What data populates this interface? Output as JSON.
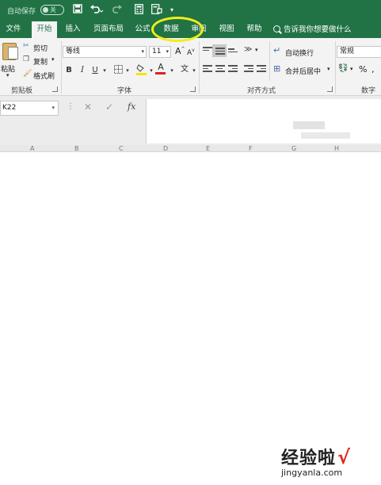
{
  "titlebar": {
    "autosave_label": "自动保存",
    "autosave_state": "关",
    "save_icon": "save-icon",
    "undo_icon": "undo-icon",
    "redo_icon": "redo-icon",
    "calc_icon": "calculator-icon",
    "form_icon": "form-icon",
    "customize_icon": "chevron-down-icon",
    "accent": "#217346"
  },
  "tabs": [
    {
      "label": "文件",
      "active": false
    },
    {
      "label": "开始",
      "active": true
    },
    {
      "label": "插入",
      "active": false
    },
    {
      "label": "页面布局",
      "active": false
    },
    {
      "label": "公式",
      "active": false
    },
    {
      "label": "数据",
      "active": false,
      "highlighted": true
    },
    {
      "label": "审阅",
      "active": false
    },
    {
      "label": "视图",
      "active": false
    },
    {
      "label": "帮助",
      "active": false
    }
  ],
  "tellme": "告诉我你想要做什么",
  "highlight_color": "#f2ee18",
  "ribbon": {
    "clipboard": {
      "paste": "粘贴",
      "cut": "剪切",
      "copy": "复制",
      "format_painter": "格式刷",
      "label": "剪贴板"
    },
    "font": {
      "name": "等线",
      "size": "11",
      "bold": "B",
      "italic": "I",
      "underline": "U",
      "grow": "A",
      "shrink": "A",
      "font_color_letter": "A",
      "wen": "文",
      "label": "字体"
    },
    "alignment": {
      "wrap_text": "自动换行",
      "merge_center": "合并后居中",
      "label": "对齐方式"
    },
    "number": {
      "format": "常规",
      "percent": "%",
      "label": "数字"
    }
  },
  "formula_bar": {
    "name_box": "K22",
    "cancel": "✕",
    "enter": "✓",
    "fx": "fx",
    "value": ""
  },
  "columns": [
    "A",
    "B",
    "C",
    "D",
    "E",
    "F",
    "G",
    "H"
  ],
  "watermark": {
    "title": "经验啦",
    "check": "√",
    "url": "jingyanla.com"
  }
}
